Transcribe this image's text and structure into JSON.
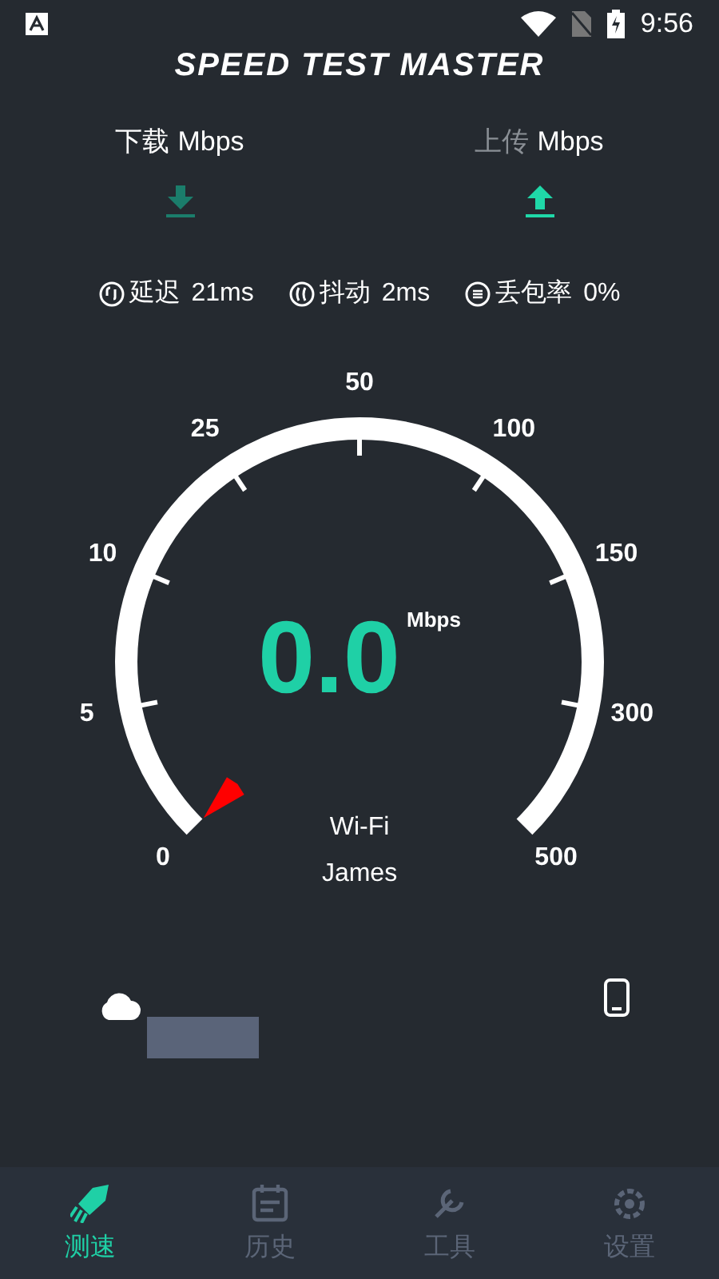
{
  "status_bar": {
    "time": "9:56"
  },
  "title": "SPEED TEST MASTER",
  "modes": [
    {
      "kind": "download",
      "label": "下载",
      "unit": "Mbps",
      "selected": false
    },
    {
      "kind": "upload",
      "label": "上传",
      "unit": "Mbps",
      "selected": true
    }
  ],
  "metrics": [
    {
      "kind": "ping",
      "label": "延迟",
      "value": "21ms"
    },
    {
      "kind": "jitter",
      "label": "抖动",
      "value": "2ms"
    },
    {
      "kind": "loss",
      "label": "丢包率",
      "value": "0%"
    }
  ],
  "gauge": {
    "scale": [
      "0",
      "5",
      "10",
      "25",
      "50",
      "100",
      "150",
      "300",
      "500"
    ],
    "reading": "0.0",
    "unit": "Mbps",
    "network": "Wi-Fi",
    "network_name": "James"
  },
  "tabs": [
    {
      "kind": "speed",
      "label": "测速",
      "selected": true
    },
    {
      "kind": "history",
      "label": "历史",
      "selected": false
    },
    {
      "kind": "tools",
      "label": "工具",
      "selected": false
    },
    {
      "kind": "settings",
      "label": "设置",
      "selected": false
    }
  ]
}
